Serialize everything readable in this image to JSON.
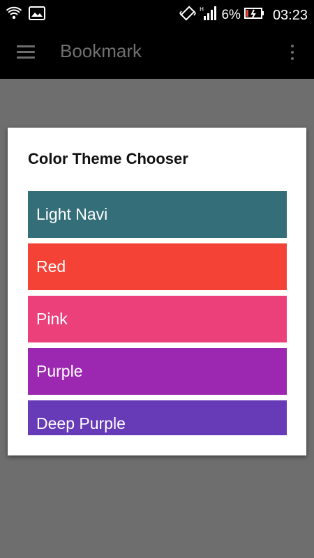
{
  "status_bar": {
    "battery_percent": "6%",
    "time": "03:23",
    "icons": [
      "wifi-hotspot-icon",
      "image-icon",
      "vibrate-icon",
      "signal-icon",
      "battery-icon"
    ]
  },
  "app_bar": {
    "title": "Bookmark",
    "menu_icon": "hamburger-menu-icon",
    "overflow_icon": "overflow-menu-icon"
  },
  "dialog": {
    "title": "Color Theme Chooser",
    "themes": [
      {
        "label": "Light Navi",
        "color": "#336e79"
      },
      {
        "label": "Red",
        "color": "#f44336"
      },
      {
        "label": "Pink",
        "color": "#ec407a"
      },
      {
        "label": "Purple",
        "color": "#9c27b0"
      },
      {
        "label": "Deep Purple",
        "color": "#673ab7"
      }
    ]
  },
  "colors": {
    "status_bar_bg": "#000000",
    "app_bar_bg": "#000000",
    "scrim": "#6e6e6e",
    "dialog_bg": "#ffffff"
  }
}
